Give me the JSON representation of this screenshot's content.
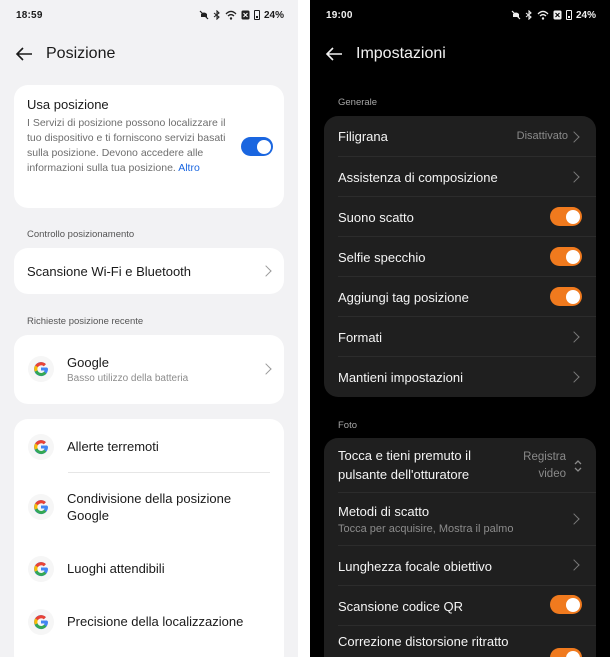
{
  "left": {
    "status": {
      "time": "18:59",
      "battery": "24%"
    },
    "title": "Posizione",
    "use_location": {
      "title": "Usa posizione",
      "description": "I Servizi di posizione possono localizzare il tuo dispositivo e ti forniscono servizi basati sulla posizione. Devono accedere alle informazioni sulla tua posizione.",
      "link": "Altro",
      "enabled": true
    },
    "section_control": "Controllo posizionamento",
    "wifi_bt_scan": "Scansione Wi-Fi e Bluetooth",
    "section_recent": "Richieste posizione recente",
    "recent": [
      {
        "name": "Google",
        "sub": "Basso utilizzo della batteria"
      }
    ],
    "services": [
      {
        "name": "Allerte terremoti"
      },
      {
        "name": "Condivisione della posizione Google"
      },
      {
        "name": "Luoghi attendibili"
      },
      {
        "name": "Precisione della localizzazione"
      }
    ],
    "colors": {
      "accent": "#1a66e0",
      "background": "#f2f2f4",
      "card": "#ffffff"
    }
  },
  "right": {
    "status": {
      "time": "19:00",
      "battery": "24%"
    },
    "title": "Impostazioni",
    "section_general": "Generale",
    "general": [
      {
        "label": "Filigrana",
        "value": "Disattivato",
        "type": "chevron"
      },
      {
        "label": "Assistenza di composizione",
        "type": "chevron"
      },
      {
        "label": "Suono scatto",
        "type": "toggle",
        "on": true
      },
      {
        "label": "Selfie specchio",
        "type": "toggle",
        "on": true
      },
      {
        "label": "Aggiungi tag posizione",
        "type": "toggle",
        "on": true
      },
      {
        "label": "Formati",
        "type": "chevron"
      },
      {
        "label": "Mantieni impostazioni",
        "type": "chevron"
      }
    ],
    "section_photo": "Foto",
    "photo": [
      {
        "label": "Tocca e tieni premuto il pulsante dell'otturatore",
        "value": "Registra video",
        "type": "select"
      },
      {
        "label": "Metodi di scatto",
        "sub": "Tocca per acquisire, Mostra il palmo",
        "type": "chevron"
      },
      {
        "label": "Lunghezza focale obiettivo",
        "type": "chevron"
      },
      {
        "label": "Scansione codice QR",
        "type": "toggle",
        "on": true
      },
      {
        "label": "Correzione distorsione ritratto",
        "type": "toggle",
        "on": true
      }
    ],
    "colors": {
      "accent": "#f07a1e",
      "background": "#000000",
      "card": "#1f1f1f"
    }
  },
  "icons": [
    "back-arrow-icon",
    "chevron-right-icon",
    "google-icon",
    "mute-icon",
    "bluetooth-icon",
    "wifi-icon",
    "battery-icon"
  ]
}
